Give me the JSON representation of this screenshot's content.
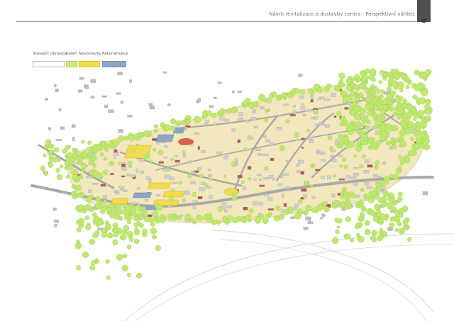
{
  "header": {
    "title": "Návrh revitalizace a dostavby centra - Perspektivní náhled"
  },
  "legend": {
    "items": [
      {
        "label": "Stávající zástavba",
        "color": "#ffffff",
        "border": "#b8b8b8"
      },
      {
        "label": "Zeleň",
        "color": "#c6ec7a",
        "border": "#aed65e"
      },
      {
        "label": "Novostavby",
        "color": "#f0dc4c",
        "border": "#d9c232"
      },
      {
        "label": "Rekonstrukce",
        "color": "#8ea6c4",
        "border": "#7890b0"
      }
    ]
  },
  "colors": {
    "terrain": "#f3e7bd",
    "road": "#a9a9a9",
    "tree": "#bfe86e",
    "building": "#bdbdbd",
    "roof_red": "#b85a4a"
  }
}
